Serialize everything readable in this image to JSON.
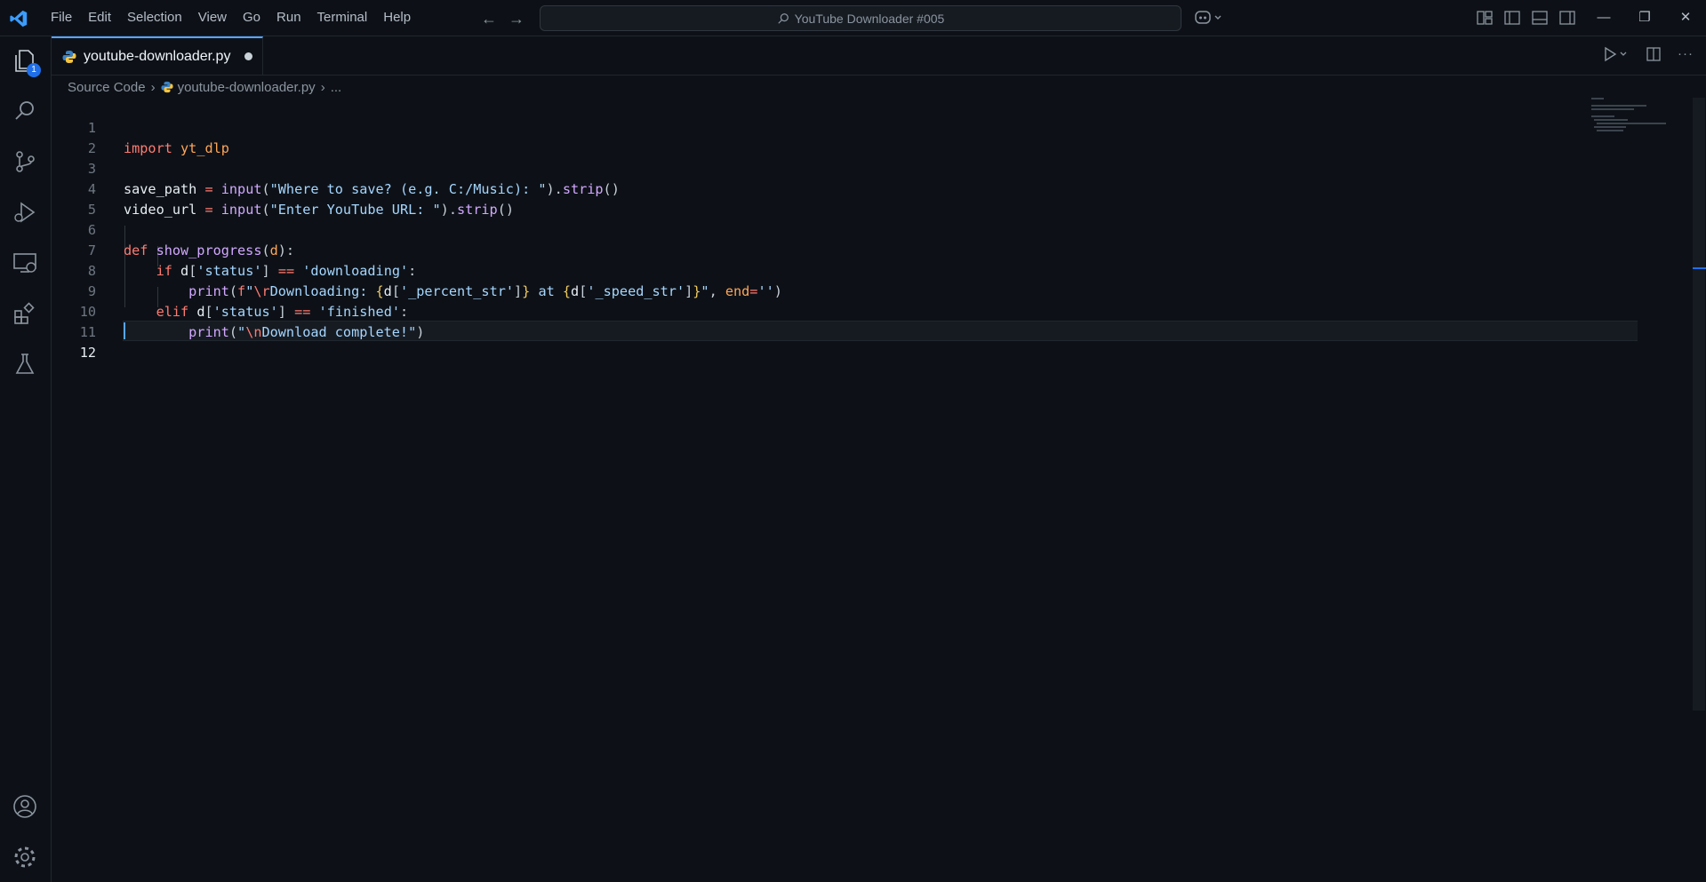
{
  "window": {
    "title": "YouTube Downloader #005",
    "menu": [
      "File",
      "Edit",
      "Selection",
      "View",
      "Go",
      "Run",
      "Terminal",
      "Help"
    ]
  },
  "activity_bar": {
    "explorer_badge": "1",
    "items": [
      "explorer-icon",
      "search-icon",
      "source-control-icon",
      "run-debug-icon",
      "remote-explorer-icon",
      "extensions-icon",
      "testing-icon"
    ],
    "bottom": [
      "account-icon",
      "settings-gear-icon"
    ]
  },
  "tab": {
    "filename": "youtube-downloader.py",
    "modified": true
  },
  "breadcrumb": {
    "folder": "Source Code",
    "file": "youtube-downloader.py",
    "more": "..."
  },
  "editor": {
    "current_line": 12,
    "line_numbers": [
      "1",
      "2",
      "3",
      "4",
      "5",
      "6",
      "7",
      "8",
      "9",
      "10",
      "11",
      "12"
    ]
  },
  "colors": {
    "accent": "#58a6ff",
    "background": "#0d1117",
    "keyword": "#ff7b72",
    "string": "#a5d6ff",
    "function": "#d2a8ff"
  }
}
